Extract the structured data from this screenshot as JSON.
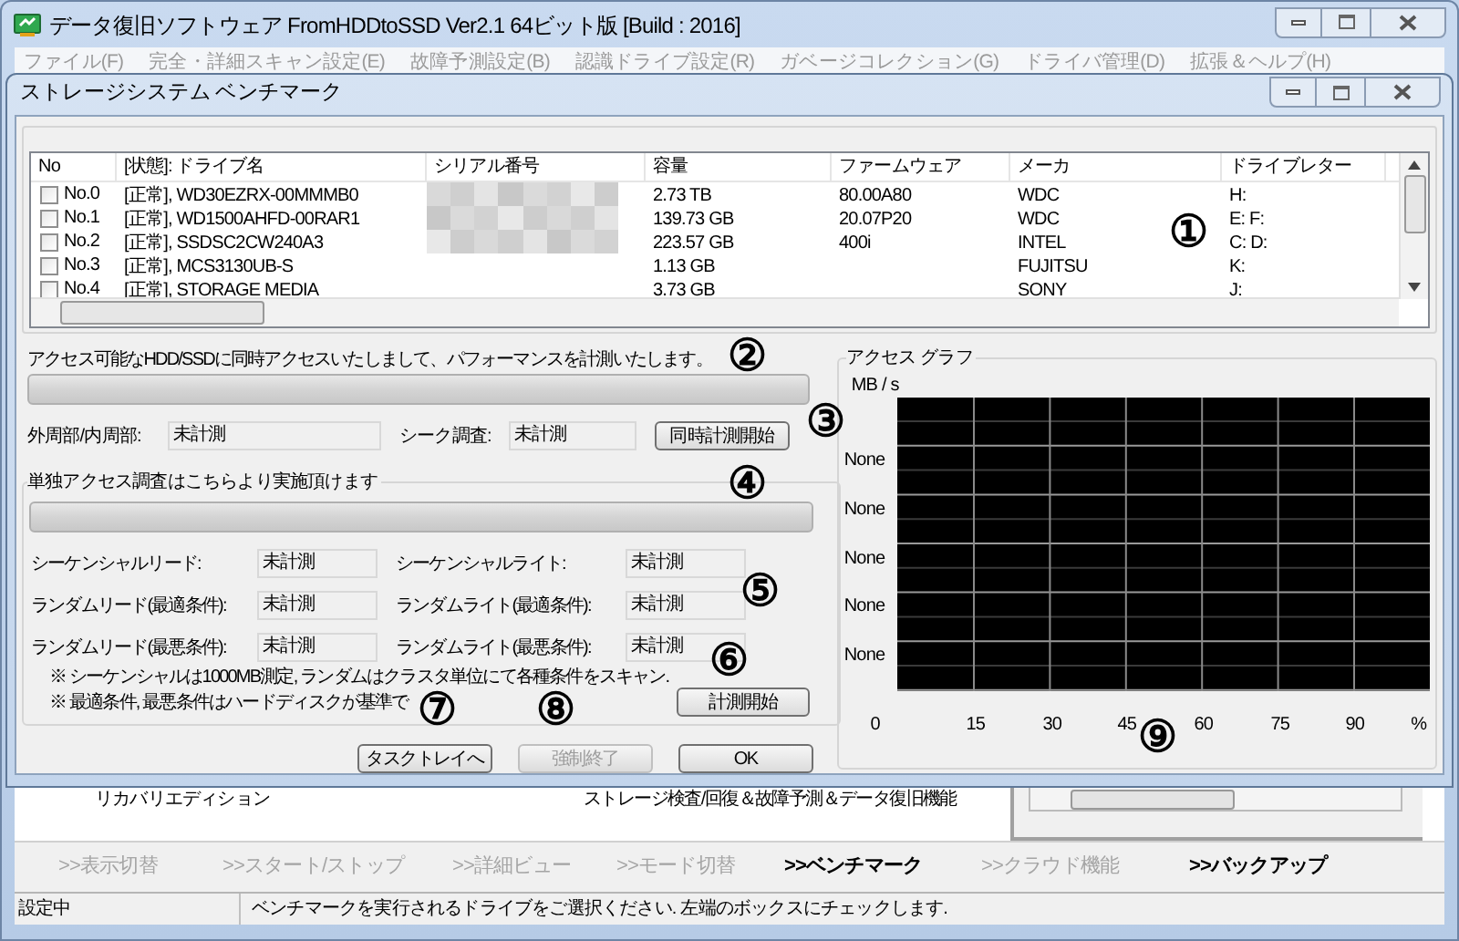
{
  "main_window": {
    "title": "データ復旧ソフトウェア FromHDDtoSSD Ver2.1 64ビット版 [Build : 2016]",
    "menu": [
      {
        "label": "ファイル(F)",
        "disabled": true
      },
      {
        "label": "完全・詳細スキャン設定(E)",
        "disabled": true
      },
      {
        "label": "故障予測設定(B)",
        "disabled": true
      },
      {
        "label": "認識ドライブ設定(R)",
        "disabled": true
      },
      {
        "label": "ガベージコレクション(G)",
        "disabled": true
      },
      {
        "label": "ドライバ管理(D)",
        "disabled": true
      },
      {
        "label": "拡張＆ヘルプ(H)",
        "disabled": true
      }
    ],
    "edition": "リカバリエディション",
    "feature": "ストレージ検査/回復＆故障予測＆データ復旧機能",
    "nav": [
      {
        "label": ">>表示切替",
        "disabled": true
      },
      {
        "label": ">>スタート/ストップ",
        "disabled": true
      },
      {
        "label": ">>詳細ビュー",
        "disabled": true
      },
      {
        "label": ">>モード切替",
        "disabled": true
      },
      {
        "label": ">>ベンチマーク",
        "disabled": false
      },
      {
        "label": ">>クラウド機能",
        "disabled": true
      },
      {
        "label": ">>バックアップ",
        "disabled": false
      }
    ],
    "status_bar": [
      "設定中",
      "ベンチマークを実行されるドライブをご選択ください. 左端のボックスにチェックします."
    ]
  },
  "dialog": {
    "title": "ストレージシステム ベンチマーク",
    "drive_table": {
      "columns": [
        "No",
        "[状態]: ドライブ名",
        "シリアル番号",
        "容量",
        "ファームウェア",
        "メーカ",
        "ドライブレター"
      ],
      "rows": [
        {
          "checked": false,
          "no": "No.0",
          "drive": "[正常], WD30EZRX-00MMMB0",
          "serial_blurred": true,
          "capacity": "2.73 TB",
          "firmware": "80.00A80",
          "maker": "WDC",
          "letters": "H:"
        },
        {
          "checked": false,
          "no": "No.1",
          "drive": "[正常], WD1500AHFD-00RAR1",
          "serial_blurred": true,
          "capacity": "139.73 GB",
          "firmware": "20.07P20",
          "maker": "WDC",
          "letters": "E: F:"
        },
        {
          "checked": false,
          "no": "No.2",
          "drive": "[正常], SSDSC2CW240A3",
          "serial_blurred": true,
          "capacity": "223.57 GB",
          "firmware": "400i",
          "maker": "INTEL",
          "letters": "C: D:"
        },
        {
          "checked": false,
          "no": "No.3",
          "drive": "[正常], MCS3130UB-S",
          "serial_blurred": false,
          "capacity": "1.13 GB",
          "firmware": "",
          "maker": "FUJITSU",
          "letters": "K:"
        },
        {
          "checked": false,
          "no": "No.4",
          "drive": "[正常], STORAGE MEDIA",
          "serial_blurred": false,
          "capacity": "3.73 GB",
          "firmware": "",
          "maker": "SONY",
          "letters": "J:"
        }
      ]
    },
    "concurrent": {
      "description": "アクセス可能なHDD/SSDに同時アクセスいたしまして、パフォーマンスを計測いたします。",
      "progress": {
        "level": 0
      },
      "fields": [
        {
          "label": "外周部/内周部:",
          "value": "未計測"
        },
        {
          "label": "シーク調査:",
          "value": "未計測"
        }
      ],
      "start_button": "同時計測開始"
    },
    "single": {
      "title": "単独アクセス調査はこちらより実施頂けます",
      "progress": {
        "level": 0
      },
      "fields": [
        {
          "label": "シーケンシャルリード:",
          "value": "未計測"
        },
        {
          "label": "シーケンシャルライト:",
          "value": "未計測"
        },
        {
          "label": "ランダムリード(最適条件):",
          "value": "未計測"
        },
        {
          "label": "ランダムライト(最適条件):",
          "value": "未計測"
        },
        {
          "label": "ランダムリード(最悪条件):",
          "value": "未計測"
        },
        {
          "label": "ランダムライト(最悪条件):",
          "value": "未計測"
        }
      ],
      "notes": [
        "※ シーケンシャルは1000MB測定, ランダムはクラスタ単位にて各種条件をスキャン.",
        "※ 最適条件, 最悪条件はハードディスクが基準で"
      ],
      "start_button": "計測開始"
    },
    "buttons": [
      {
        "label": "タスクトレイへ",
        "disabled": false
      },
      {
        "label": "強制終了",
        "disabled": true
      },
      {
        "label": "OK",
        "disabled": false
      }
    ],
    "graph": {
      "title": "アクセス グラフ",
      "unit": "MB / s",
      "y_labels": [
        "None",
        "None",
        "None",
        "None",
        "None"
      ],
      "x_labels": [
        "0",
        "15",
        "30",
        "45",
        "60",
        "75",
        "90",
        "%"
      ]
    },
    "callouts": [
      "①",
      "②",
      "③",
      "④",
      "⑤",
      "⑥",
      "⑦",
      "⑧",
      "⑨"
    ]
  }
}
